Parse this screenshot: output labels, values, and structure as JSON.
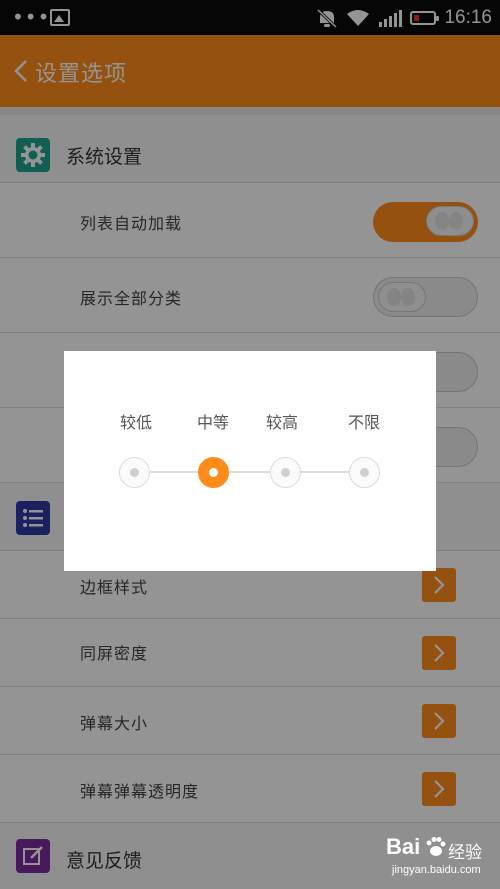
{
  "status_bar": {
    "time": "16:16",
    "icons": [
      "overflow-dots-icon",
      "image-icon",
      "mute-icon",
      "wifi-icon",
      "signal-icon",
      "battery-icon"
    ]
  },
  "header": {
    "title": "设置选项",
    "back_icon": "back-chevron-icon"
  },
  "colors": {
    "accent": "#ff8c1a",
    "system_icon": "#1ea48a",
    "list_icon": "#2d3aa6",
    "feedback_icon": "#7a2ea0"
  },
  "groups": {
    "system": {
      "title": "系统设置",
      "icon": "gear-icon",
      "rows": [
        {
          "label": "列表自动加载",
          "toggle": "on"
        },
        {
          "label": "展示全部分类",
          "toggle": "off"
        },
        {
          "label": "",
          "toggle": "off"
        },
        {
          "label": "",
          "toggle": "off"
        }
      ]
    },
    "danmaku": {
      "title": "",
      "icon": "list-icon",
      "rows": [
        {
          "label": "边框样式"
        },
        {
          "label": "同屏密度"
        },
        {
          "label": "弹幕大小"
        },
        {
          "label": "弹幕弹幕透明度"
        }
      ]
    },
    "feedback": {
      "title": "意见反馈",
      "icon": "edit-icon"
    }
  },
  "dialog": {
    "levels": [
      "较低",
      "中等",
      "较高",
      "不限"
    ],
    "selected_index": 1
  },
  "watermark": {
    "brand": "Bai",
    "product": "经验",
    "url": "jingyan.baidu.com"
  }
}
